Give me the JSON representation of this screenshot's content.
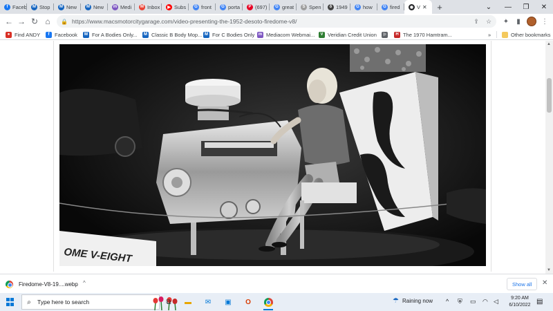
{
  "browser": {
    "tabs": [
      {
        "label": "Faceb",
        "icon": "facebook-icon",
        "color": "#1877f2",
        "glyph": "f"
      },
      {
        "label": "Stop",
        "icon": "mopar-icon",
        "color": "#1565c0",
        "glyph": "M"
      },
      {
        "label": "New",
        "icon": "mopar-icon",
        "color": "#1565c0",
        "glyph": "M"
      },
      {
        "label": "New",
        "icon": "mopar-icon",
        "color": "#1565c0",
        "glyph": "M"
      },
      {
        "label": "Medi",
        "icon": "mediacom-icon",
        "color": "#7e57c2",
        "glyph": "m"
      },
      {
        "label": "Inbox",
        "icon": "gmail-icon",
        "color": "#ea4335",
        "glyph": "M"
      },
      {
        "label": "Subs",
        "icon": "youtube-icon",
        "color": "#ff0000",
        "glyph": "▶"
      },
      {
        "label": "front",
        "icon": "google-icon",
        "color": "#4285f4",
        "glyph": "G"
      },
      {
        "label": "porta",
        "icon": "google-icon",
        "color": "#4285f4",
        "glyph": "G"
      },
      {
        "label": "(697)",
        "icon": "pinterest-icon",
        "color": "#e60023",
        "glyph": "P"
      },
      {
        "label": "great",
        "icon": "google-icon",
        "color": "#4285f4",
        "glyph": "G"
      },
      {
        "label": "Spen",
        "icon": "page-icon",
        "color": "#9e9e9e",
        "glyph": "S"
      },
      {
        "label": "1949",
        "icon": "site-icon",
        "color": "#424242",
        "glyph": "δ"
      },
      {
        "label": "how",
        "icon": "google-icon",
        "color": "#4285f4",
        "glyph": "G"
      },
      {
        "label": "fired",
        "icon": "google-icon",
        "color": "#4285f4",
        "glyph": "G"
      },
      {
        "label": "V",
        "icon": "macs-garage-icon",
        "color": "#202124",
        "glyph": "◉",
        "active": true
      }
    ],
    "url": "https://www.macsmotorcitygarage.com/video-presenting-the-1952-desoto-firedome-v8/",
    "bookmarks": [
      {
        "label": "Find ANDY",
        "icon": "andy-icon",
        "color": "#d93025",
        "glyph": "●"
      },
      {
        "label": "Facebook",
        "icon": "facebook-icon",
        "color": "#1877f2",
        "glyph": "f"
      },
      {
        "label": "For A Bodies Only...",
        "icon": "mopar-icon",
        "color": "#1565c0",
        "glyph": "M"
      },
      {
        "label": "Classic B Body Mop...",
        "icon": "mopar-icon",
        "color": "#1565c0",
        "glyph": "M"
      },
      {
        "label": "For C Bodies Only",
        "icon": "mopar-icon",
        "color": "#1565c0",
        "glyph": "M"
      },
      {
        "label": "Mediacom Webmai...",
        "icon": "mediacom-icon",
        "color": "#7e57c2",
        "glyph": "m"
      },
      {
        "label": "Veridian Credit Union",
        "icon": "veridian-icon",
        "color": "#2e7d32",
        "glyph": "V"
      },
      {
        "label": "",
        "icon": "chrysler-icon",
        "color": "#5f6368",
        "glyph": "⚐"
      },
      {
        "label": "The 1970 Hamtram...",
        "icon": "hamtramck-icon",
        "color": "#c62828",
        "glyph": "H"
      }
    ],
    "more_bookmarks": "»",
    "other_bookmarks": "Other bookmarks"
  },
  "photo": {
    "sign_text": "OME V-EIGHT"
  },
  "download_shelf": {
    "filename": "Firedome-V8-19....webp",
    "show_all": "Show all"
  },
  "taskbar": {
    "search_placeholder": "Type here to search",
    "weather": "Raining now",
    "time": "9:20 AM",
    "date": "6/10/2022"
  },
  "colors": {
    "accent": "#1a73e8",
    "tabstrip": "#dee1e6",
    "taskbar": "#e8eef6"
  }
}
